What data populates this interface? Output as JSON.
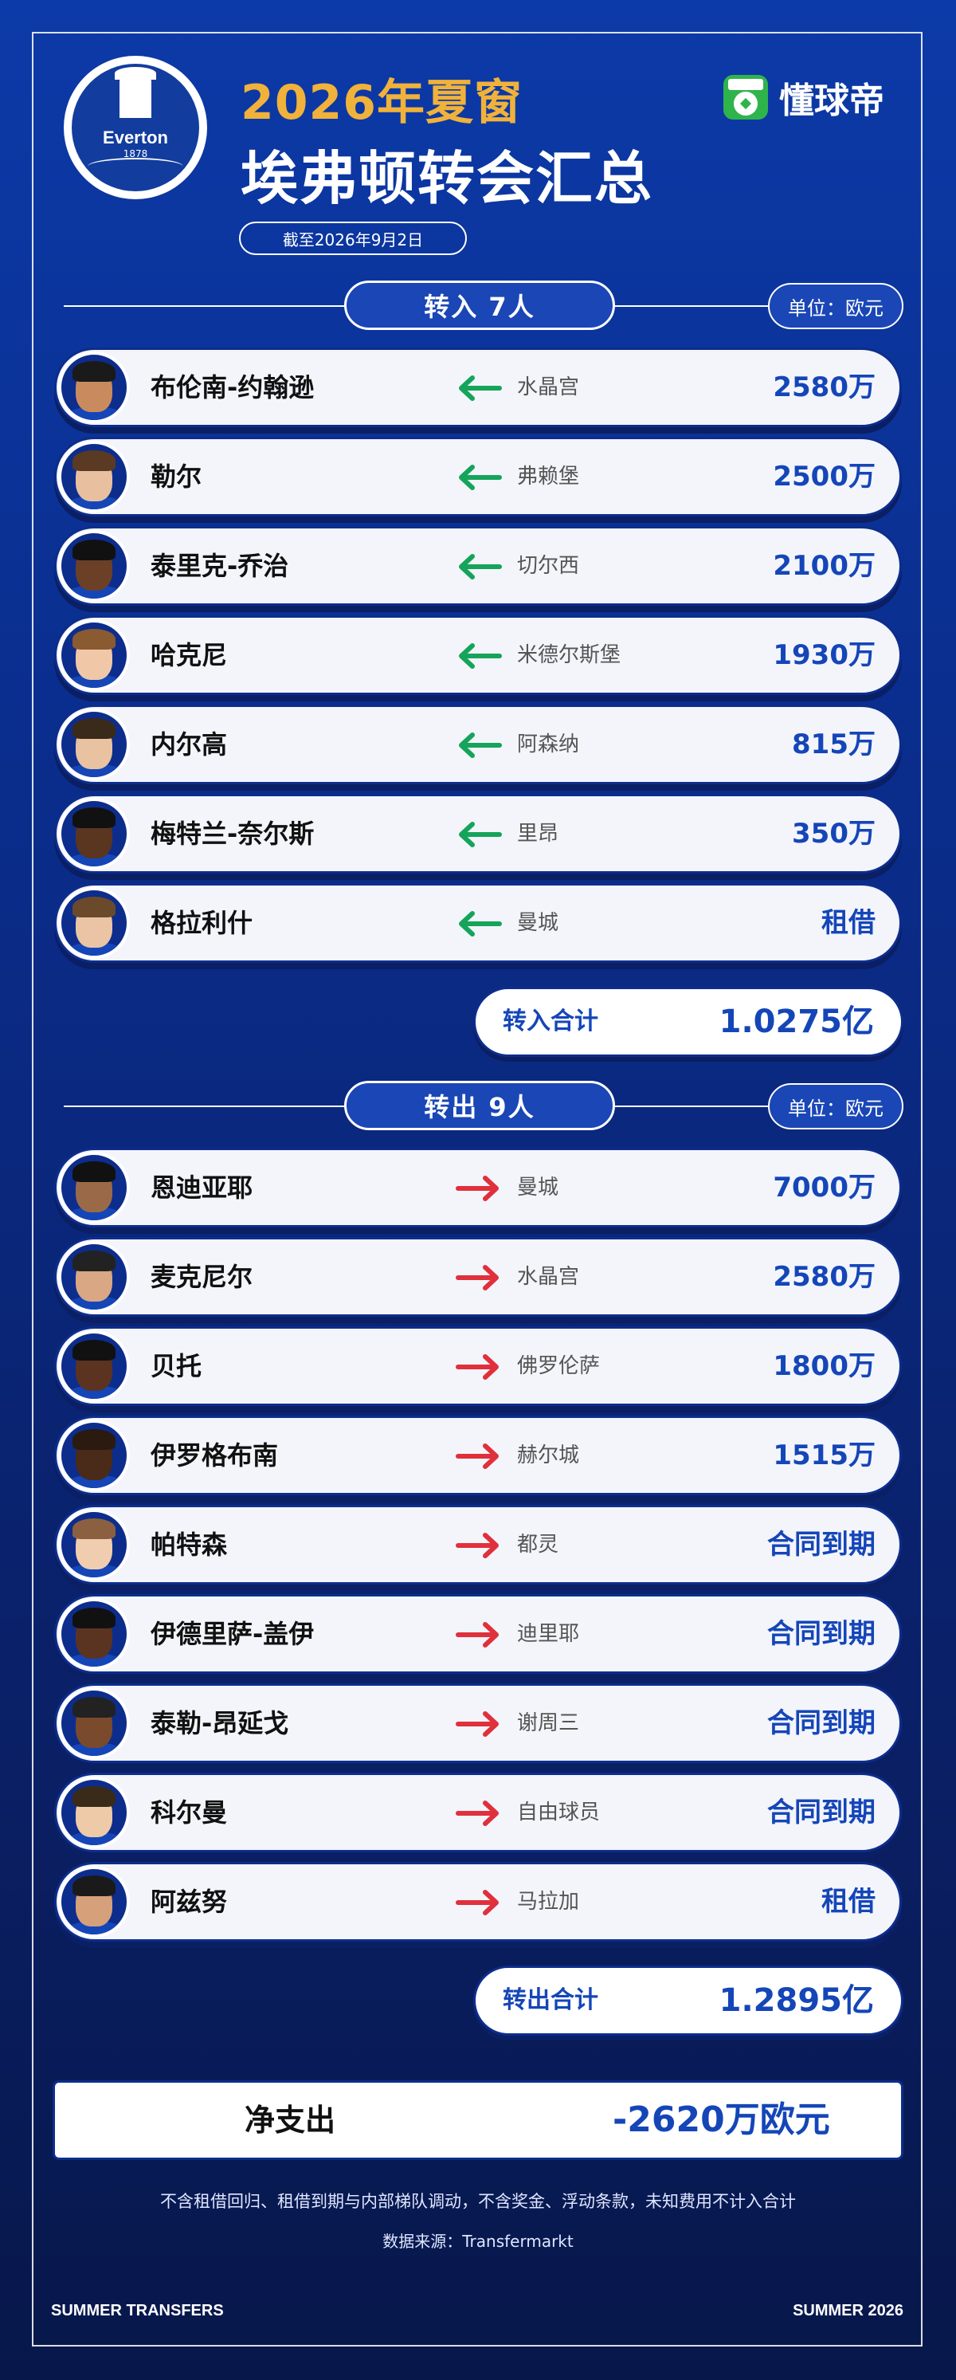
{
  "header": {
    "crest_word": "Everton",
    "crest_year": "1878",
    "title_year": "2026年夏窗",
    "title_main": "埃弗顿转会汇总",
    "date": "截至2026年9月2日",
    "brand_name": "懂球帝"
  },
  "colors": {
    "in_arrow": "#16a45a",
    "out_arrow": "#e0303c",
    "accent": "#1546b8",
    "title_gold": "#f0b23a"
  },
  "in_section": {
    "label": "转入 7人",
    "unit": "单位：欧元",
    "players": [
      {
        "name": "布伦南-约翰逊",
        "club": "水晶宫",
        "fee": "2580万"
      },
      {
        "name": "勒尔",
        "club": "弗赖堡",
        "fee": "2500万"
      },
      {
        "name": "泰里克-乔治",
        "club": "切尔西",
        "fee": "2100万"
      },
      {
        "name": "哈克尼",
        "club": "米德尔斯堡",
        "fee": "1930万"
      },
      {
        "name": "内尔高",
        "club": "阿森纳",
        "fee": "815万"
      },
      {
        "name": "梅特兰-奈尔斯",
        "club": "里昂",
        "fee": "350万"
      },
      {
        "name": "格拉利什",
        "club": "曼城",
        "fee": "租借"
      }
    ],
    "total_label": "转入合计",
    "total_value": "1.0275亿"
  },
  "out_section": {
    "label": "转出 9人",
    "unit": "单位：欧元",
    "players": [
      {
        "name": "恩迪亚耶",
        "club": "曼城",
        "fee": "7000万"
      },
      {
        "name": "麦克尼尔",
        "club": "水晶宫",
        "fee": "2580万"
      },
      {
        "name": "贝托",
        "club": "佛罗伦萨",
        "fee": "1800万"
      },
      {
        "name": "伊罗格布南",
        "club": "赫尔城",
        "fee": "1515万"
      },
      {
        "name": "帕特森",
        "club": "都灵",
        "fee": "合同到期"
      },
      {
        "name": "伊德里萨-盖伊",
        "club": "迪里耶",
        "fee": "合同到期"
      },
      {
        "name": "泰勒-昂延戈",
        "club": "谢周三",
        "fee": "合同到期"
      },
      {
        "name": "科尔曼",
        "club": "自由球员",
        "fee": "合同到期"
      },
      {
        "name": "阿兹努",
        "club": "马拉加",
        "fee": "租借"
      }
    ],
    "total_label": "转出合计",
    "total_value": "1.2895亿"
  },
  "net": {
    "label": "净支出",
    "value": "-2620万欧元"
  },
  "footer": {
    "note": "不含租借回归、租借到期与内部梯队调动，不含奖金、浮动条款，未知费用不计入合计",
    "source": "数据来源：Transfermarkt",
    "left_tag": "SUMMER TRANSFERS",
    "right_tag": "SUMMER 2026"
  }
}
